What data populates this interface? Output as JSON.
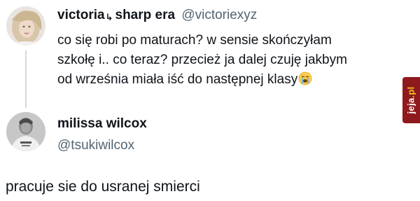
{
  "tweet1": {
    "display_name": "victoria",
    "name_glyph": "↳",
    "display_name_suffix": "sharp era",
    "handle": "@victoriexyz",
    "text_lines": [
      "co się robi po maturach? w sensie skończyłam",
      "szkołę i.. co teraz? przecież ja dalej czuję jakbym",
      "od września miała iść do następnej klasy"
    ],
    "emoji": "loudly-crying-face-emoji"
  },
  "tweet2": {
    "display_name": "milissa wilcox",
    "handle": "@tsukiwilcox"
  },
  "reply_text": "pracuje sie do usranej smierci",
  "watermark": {
    "text_main": "jeja",
    "text_accent": ".pl"
  },
  "colors": {
    "text": "#0f1419",
    "secondary_text": "#536471",
    "thread_line": "#cfd9de",
    "watermark_bg": "#8e1a1d",
    "watermark_accent": "#f2c21b"
  }
}
